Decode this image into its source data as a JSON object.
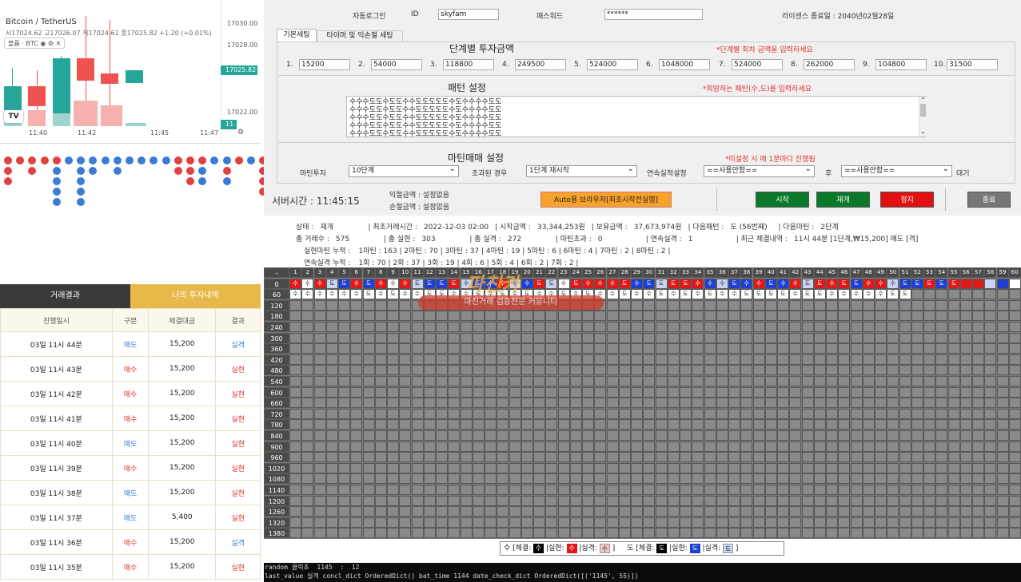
{
  "chart": {
    "symbol": "Bitcoin / TetherUS",
    "ohlc": "시17024.62 고17026.07 저17024.61 종17025.82 +1.20 (+0.01%)",
    "tools_label": "볼륨 · BTC",
    "price_ticks": [
      "17030.00",
      "17028.00",
      "17022.00"
    ],
    "price_tag": "17025.82",
    "time_tag": "11",
    "time_ticks": [
      "11:40",
      "11:42",
      "11:45",
      "11:47"
    ],
    "logo": "TV"
  },
  "colors": {
    "up": "#26a69a",
    "down": "#ef5350",
    "sell": "#3a7bd5",
    "buy": "#dd3333",
    "accent": "#e6b94a"
  },
  "left_tabs": {
    "trade_results": "거래결과",
    "my_investments": "나의 투자내역"
  },
  "left_table": {
    "headers": [
      "진행일시",
      "구분",
      "체결대금",
      "결과"
    ],
    "rows": [
      [
        "03일 11시 44분",
        "매도",
        "15,200",
        "실격"
      ],
      [
        "03일 11시 43분",
        "매수",
        "15,200",
        "실현"
      ],
      [
        "03일 11시 42분",
        "매수",
        "15,200",
        "실현"
      ],
      [
        "03일 11시 41분",
        "매수",
        "15,200",
        "실현"
      ],
      [
        "03일 11시 40분",
        "매도",
        "15,200",
        "실현"
      ],
      [
        "03일 11시 39분",
        "매수",
        "15,200",
        "실현"
      ],
      [
        "03일 11시 38분",
        "매도",
        "15,200",
        "실현"
      ],
      [
        "03일 11시 37분",
        "매도",
        "5,400",
        "실현"
      ],
      [
        "03일 11시 36분",
        "매수",
        "15,200",
        "실격"
      ],
      [
        "03일 11시 35분",
        "매수",
        "15,200",
        "실현"
      ]
    ]
  },
  "login": {
    "auto_login": "자동로그인",
    "id_label": "ID",
    "id_value": "skyfam",
    "pw_label": "패스워드",
    "pw_value": "******",
    "license": "라이센스 종료일 : 2040년02월28일"
  },
  "tabs": {
    "basic": "기본세팅",
    "timer": "타이머 및 익손절 세팅"
  },
  "stage": {
    "title": "단계별 투자금액",
    "note": "*단계별 회차 금액을 입력하세요",
    "items": [
      [
        "1.",
        "15200"
      ],
      [
        "2.",
        "54000"
      ],
      [
        "3.",
        "118800"
      ],
      [
        "4.",
        "249500"
      ],
      [
        "5.",
        "524000"
      ],
      [
        "6.",
        "1048000"
      ],
      [
        "7.",
        "524000"
      ],
      [
        "8.",
        "262000"
      ],
      [
        "9.",
        "104800"
      ],
      [
        "10.",
        "31500"
      ]
    ]
  },
  "pattern": {
    "title": "패턴 설정",
    "note": "*희망하는 패턴(수,도)를 입력하세요",
    "text": "수수수도도수도도수수도도도도도수도수수수수도도\n수수수도도수도도수수도도도도도수도수수수수도도\n수수수도도수도도수수도도도도도수도수수수수도도\n수수수도도수도도수수도도도도도수도수수수수도도\n수수수도도수도도수수도도도도도수도수수수수도도"
  },
  "martin": {
    "title": "마틴매매 설정",
    "note": "*미설정 시 매 1분마다 진행됨",
    "invest_label": "마틴투자",
    "invest_value": "10단계",
    "exceed_label": "초과된 경우",
    "exceed_value": "1단계 재시작",
    "consec_label": "연속실적설정",
    "consec_value": "==사용안함==",
    "after_label": "후",
    "after_value": "==사용안함==",
    "wait_label": "대기"
  },
  "server": {
    "time": "서버시간 : 11:45:15",
    "profit": "익절금액 : 설정없음",
    "loss": "손절금액 : 설정없음"
  },
  "buttons": {
    "auto_browser": "Auto용 브라우저[최초시작전실행]",
    "start": "시작",
    "resume": "재개",
    "stop": "정지",
    "exit": "종료"
  },
  "status": {
    "row1": [
      [
        "상태 :",
        "재개"
      ],
      [
        "| 최초거래시간 :",
        "2022-12-03 02:00"
      ],
      [
        "| 시작금액 :",
        "33,344,253원"
      ],
      [
        "| 보유금액 :",
        "37,673,974원"
      ],
      [
        "| 다음패턴 :",
        "도 (56번째)"
      ],
      [
        "| 다음마틴 :",
        "2단계"
      ]
    ],
    "row2": [
      [
        "총 거래수 :",
        "575"
      ],
      [
        "| 총 실현 :",
        "303"
      ],
      [
        "| 총 실격 :",
        "272"
      ],
      [
        "| 마틴초과 :",
        "0"
      ],
      [
        "| 연속실격 :",
        "1"
      ],
      [
        "| 최근 체결내역 :",
        "11시 44분 [1단계,₩15,200] 매도 [격]"
      ]
    ],
    "row3_label": "실현마틴 누적 :",
    "row3": "1마틴 : 163 | 2마틴 : 70 | 3마틴 : 37 | 4마틴 : 19 | 5마틴 : 6 | 6마틴 : 4 | 7마틴 : 2 | 8마틴 : 2 |",
    "row4_label": "연속실격 누적 :",
    "row4": "1회 : 70 | 2회 : 37 | 3회 : 19 | 4회 : 6 | 5회 : 4 | 6회 : 2 | 7회 : 2 |"
  },
  "grid": {
    "corner": "-",
    "row_labels": [
      "0",
      "60",
      "120",
      "180",
      "240",
      "300",
      "360",
      "420",
      "480",
      "540",
      "600",
      "660",
      "720",
      "780",
      "840",
      "900",
      "960",
      "1020",
      "1080",
      "1140",
      "1200",
      "1260",
      "1320",
      "1380"
    ],
    "row0": "rsrlbrbrsrlbbrlbbrlbrlsrrrrrbblrrrblbbrbbrlrrrbrrlbbrbrrrlbsssls",
    "row0_text": "수수수도도수도수수수도도도도수도수수수수도도수도수수수도수도도도도수수수도수수도수수도도수도도수수수도도도도도",
    "row60_text": "수수수수수수도수도수수도도수수도수도수도수수도수도수수도수수도수도수도수수도도도도수도도수수수수수도도"
  },
  "watermark": {
    "brand": "파친카",
    "sub": "마진거래 검증전문 커뮤니티"
  },
  "legend": {
    "su": "수 [체결:",
    "su_real": "|실현:",
    "su_fail": "|실격:",
    "do": "도 [체결:",
    "do_real": "|실현:",
    "do_fail": "|실격:",
    "close": "]",
    "su_glyph": "수",
    "do_glyph": "도"
  },
  "console": {
    "line1": "random 클릭초  1145  :  12",
    "line2": "last_value 실격 concl_dict OrderedDict() bat_time 1144 date_check_dict OrderedDict([('1145', 55)])"
  }
}
